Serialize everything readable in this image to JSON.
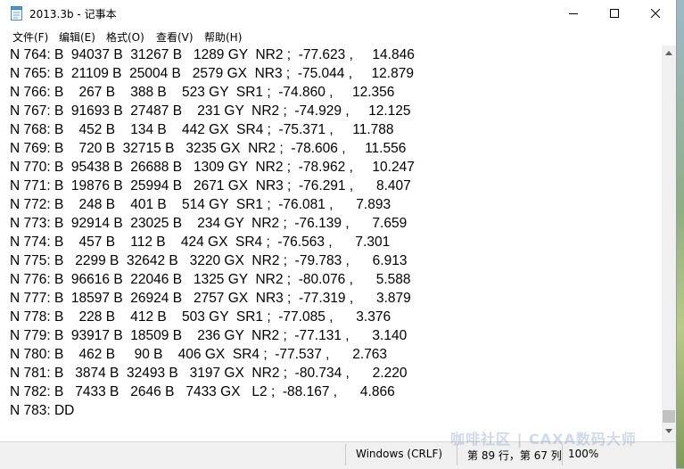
{
  "window": {
    "title": "2013.3b - 记事本",
    "icon": "notepad-icon"
  },
  "menu": [
    {
      "label": "文件(F)"
    },
    {
      "label": "编辑(E)"
    },
    {
      "label": "格式(O)"
    },
    {
      "label": "查看(V)"
    },
    {
      "label": "帮助(H)"
    }
  ],
  "editor": {
    "lines": [
      "N 764: B  94037 B  31267 B   1289 GY  NR2 ;  -77.623 ,     14.846",
      "N 765: B  21109 B  25004 B   2579 GX  NR3 ;  -75.044 ,     12.879",
      "N 766: B    267 B    388 B    523 GY  SR1 ;  -74.860 ,     12.356",
      "N 767: B  91693 B  27487 B    231 GY  NR2 ;  -74.929 ,     12.125",
      "N 768: B    452 B    134 B    442 GX  SR4 ;  -75.371 ,     11.788",
      "N 769: B    720 B  32715 B   3235 GX  NR2 ;  -78.606 ,     11.556",
      "N 770: B  95438 B  26688 B   1309 GY  NR2 ;  -78.962 ,     10.247",
      "N 771: B  19876 B  25994 B   2671 GX  NR3 ;  -76.291 ,      8.407",
      "N 772: B    248 B    401 B    514 GY  SR1 ;  -76.081 ,      7.893",
      "N 773: B  92914 B  23025 B    234 GY  NR2 ;  -76.139 ,      7.659",
      "N 774: B    457 B    112 B    424 GX  SR4 ;  -76.563 ,      7.301",
      "N 775: B   2299 B  32642 B   3220 GX  NR2 ;  -79.783 ,      6.913",
      "N 776: B  96616 B  22046 B   1325 GY  NR2 ;  -80.076 ,      5.588",
      "N 777: B  18597 B  26924 B   2757 GX  NR3 ;  -77.319 ,      3.879",
      "N 778: B    228 B    412 B    503 GY  SR1 ;  -77.085 ,      3.376",
      "N 779: B  93917 B  18509 B    236 GY  NR2 ;  -77.131 ,      3.140",
      "N 780: B    462 B     90 B    406 GX  SR4 ;  -77.537 ,      2.763",
      "N 781: B   3874 B  32493 B   3197 GX  NR2 ;  -80.734 ,      2.220",
      "N 782: B   7433 B   2646 B   7433 GX   L2 ;  -88.167 ,      4.866",
      "N 783: DD"
    ]
  },
  "status": {
    "encoding": "Windows (CRLF)",
    "position": "第 89 行，第 67 列",
    "zoom": "100%"
  },
  "watermark": "咖啡社区 | CAXA数码大师"
}
